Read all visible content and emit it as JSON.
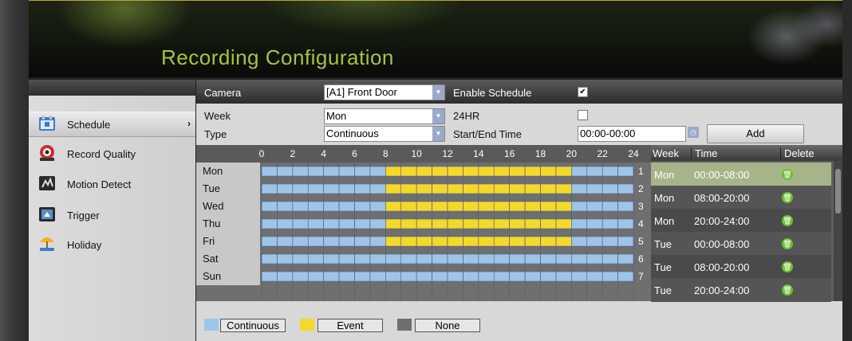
{
  "header": {
    "title": "Recording Configuration"
  },
  "sidebar": {
    "items": [
      {
        "label": "Schedule",
        "icon": "calendar-icon",
        "active": true
      },
      {
        "label": "Record Quality",
        "icon": "record-icon"
      },
      {
        "label": "Motion Detect",
        "icon": "motion-icon"
      },
      {
        "label": "Trigger",
        "icon": "trigger-icon"
      },
      {
        "label": "Holiday",
        "icon": "holiday-icon"
      }
    ]
  },
  "form": {
    "camera_label": "Camera",
    "camera_value": "[A1] Front Door",
    "enable_schedule_label": "Enable Schedule",
    "enable_schedule_checked": true,
    "week_label": "Week",
    "week_value": "Mon",
    "hr24_label": "24HR",
    "hr24_checked": false,
    "type_label": "Type",
    "type_value": "Continuous",
    "start_end_label": "Start/End Time",
    "start_end_value": "00:00-00:00",
    "add_label": "Add"
  },
  "schedule": {
    "hours": [
      "0",
      "2",
      "4",
      "6",
      "8",
      "10",
      "12",
      "14",
      "16",
      "18",
      "20",
      "22",
      "24"
    ],
    "days": [
      "Mon",
      "Tue",
      "Wed",
      "Thu",
      "Fri",
      "Sat",
      "Sun"
    ],
    "row_numbers": [
      "1",
      "2",
      "3",
      "4",
      "5",
      "6",
      "7"
    ],
    "colors": {
      "continuous": "#9ec5e8",
      "event": "#f5d92a",
      "none": "#6f6f6f"
    }
  },
  "list": {
    "headers": {
      "week": "Week",
      "time": "Time",
      "delete": "Delete"
    },
    "rows": [
      {
        "week": "Mon",
        "time": "00:00-08:00",
        "selected": true
      },
      {
        "week": "Mon",
        "time": "08:00-20:00"
      },
      {
        "week": "Mon",
        "time": "20:00-24:00"
      },
      {
        "week": "Tue",
        "time": "00:00-08:00"
      },
      {
        "week": "Tue",
        "time": "08:00-20:00"
      },
      {
        "week": "Tue",
        "time": "20:00-24:00"
      }
    ]
  },
  "legend": {
    "continuous": "Continuous",
    "event": "Event",
    "none": "None"
  }
}
